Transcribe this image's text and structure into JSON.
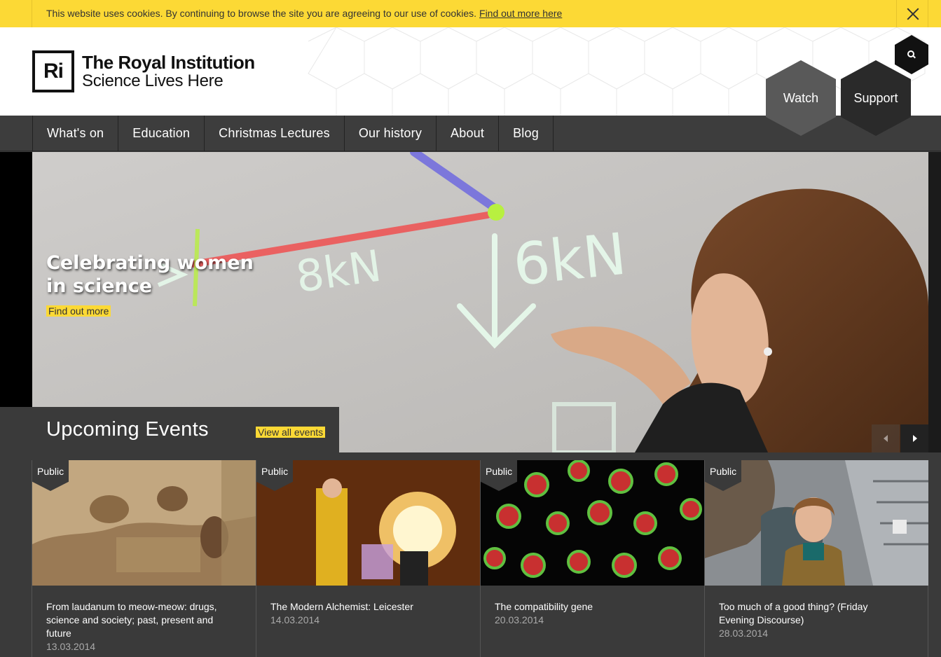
{
  "cookie_bar": {
    "text": "This website uses cookies. By continuing to browse the site you are agreeing to our use of cookies.",
    "link": "Find out more here",
    "close_icon": "close-icon"
  },
  "header": {
    "logo_mark": "Ri",
    "logo_title": "The Royal Institution",
    "logo_tagline": "Science Lives Here"
  },
  "actions": {
    "watch": "Watch",
    "support": "Support",
    "search_icon": "search-icon"
  },
  "nav": {
    "items": [
      "What's on",
      "Education",
      "Christmas Lectures",
      "Our history",
      "About",
      "Blog"
    ]
  },
  "hero": {
    "title": "Celebrating women in science",
    "cta": "Find out more",
    "board_text_1": "8kN",
    "board_text_2": "6kN",
    "prev_icon": "chevron-left-icon",
    "next_icon": "chevron-right-icon"
  },
  "events": {
    "heading": "Upcoming Events",
    "view_all": "View all events",
    "cards": [
      {
        "badge": "Public",
        "title": "From laudanum to meow-meow: drugs, science and society; past, present and future",
        "date": "13.03.2014"
      },
      {
        "badge": "Public",
        "title": "The Modern Alchemist: Leicester",
        "date": "14.03.2014"
      },
      {
        "badge": "Public",
        "title": "The compatibility gene",
        "date": "20.03.2014"
      },
      {
        "badge": "Public",
        "title": "Too much of a good thing? (Friday Evening Discourse)",
        "date": "28.03.2014"
      }
    ]
  },
  "colors": {
    "accent_yellow": "#fcd935",
    "nav_bg": "#3d3d3d",
    "dark_bg": "#3a3a3a"
  }
}
